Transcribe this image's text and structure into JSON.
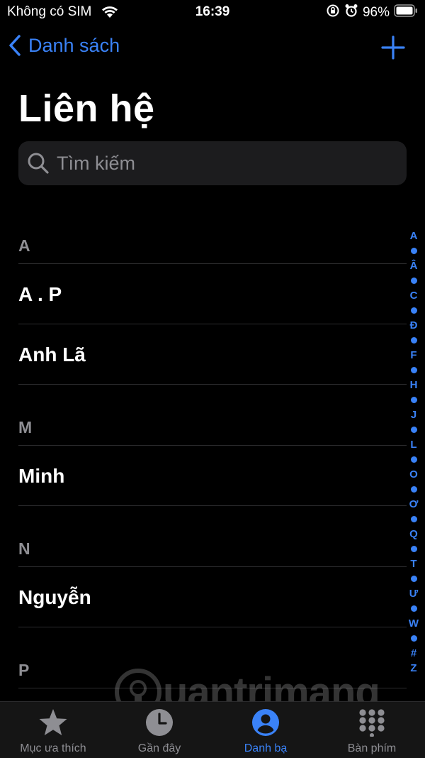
{
  "status_bar": {
    "carrier": "Không có SIM",
    "time": "16:39",
    "battery": "96%"
  },
  "nav": {
    "back_label": "Danh sách"
  },
  "title": "Liên hệ",
  "search": {
    "placeholder": "Tìm kiếm"
  },
  "sections": [
    {
      "header": "A",
      "contacts": [
        "A . P",
        "Anh Lã"
      ]
    },
    {
      "header": "M",
      "contacts": [
        "Minh"
      ]
    },
    {
      "header": "N",
      "contacts": [
        "Nguyễn"
      ]
    },
    {
      "header": "P",
      "contacts": []
    }
  ],
  "index": [
    "A",
    "•",
    "Â",
    "•",
    "C",
    "•",
    "Đ",
    "•",
    "F",
    "•",
    "H",
    "•",
    "J",
    "•",
    "L",
    "•",
    "O",
    "•",
    "Ơ",
    "•",
    "Q",
    "•",
    "T",
    "•",
    "Ư",
    "•",
    "W",
    "•",
    "#",
    "Z"
  ],
  "watermark": "uantrimang",
  "tabs": [
    {
      "label": "Mục ưa thích",
      "icon": "star-icon",
      "active": false
    },
    {
      "label": "Gần đây",
      "icon": "clock-icon",
      "active": false
    },
    {
      "label": "Danh bạ",
      "icon": "person-circle-icon",
      "active": true
    },
    {
      "label": "Bàn phím",
      "icon": "keypad-icon",
      "active": false
    }
  ],
  "colors": {
    "accent": "#3a82f7",
    "background": "#000000",
    "secondary_text": "#8e8e93",
    "search_bg": "#1c1c1e"
  }
}
